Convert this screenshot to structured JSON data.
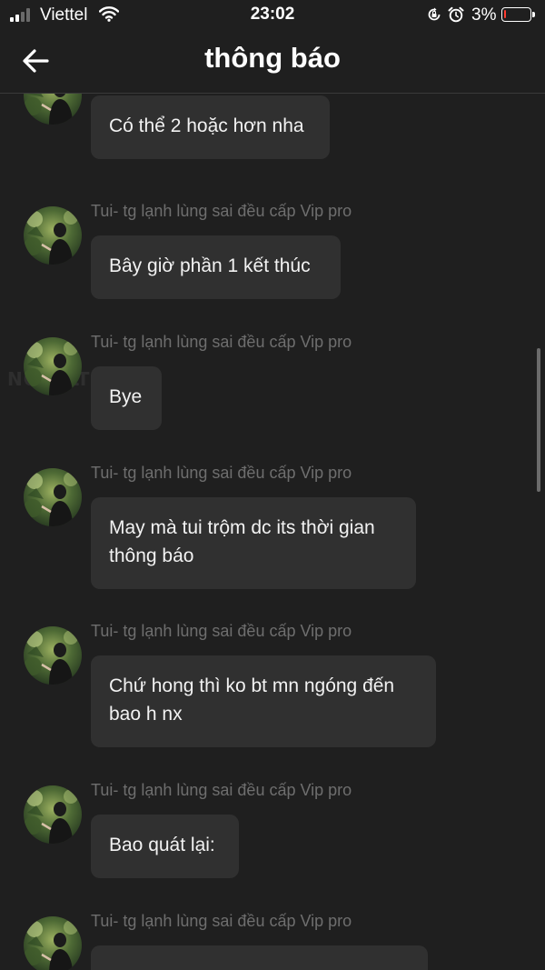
{
  "status_bar": {
    "carrier": "Viettel",
    "time": "23:02",
    "battery_percent": "3%",
    "battery_level": 0.03
  },
  "header": {
    "title": "thông báo",
    "back_icon": "arrow-left-icon"
  },
  "watermark": "NOVELTOON",
  "messages": [
    {
      "author": "",
      "text_lines": [
        "Có thể 2 hoặc hơn nha"
      ]
    },
    {
      "author": "Tui- tg lạnh lùng sai đều cấp Vip pro",
      "text_lines": [
        "Bây giờ phần 1 kết thúc"
      ]
    },
    {
      "author": "Tui- tg lạnh lùng sai đều cấp Vip pro",
      "text_lines": [
        "Bye"
      ]
    },
    {
      "author": "Tui- tg lạnh lùng sai đều cấp Vip pro",
      "text_lines": [
        "May mà tui trộm dc its thời gian",
        "thông báo"
      ]
    },
    {
      "author": "Tui- tg lạnh lùng sai đều cấp Vip pro",
      "text_lines": [
        "Chứ hong thì ko bt mn ngóng đến",
        "bao h nx"
      ]
    },
    {
      "author": "Tui- tg lạnh lùng sai đều cấp Vip pro",
      "text_lines": [
        "Bao quát lại:"
      ]
    },
    {
      "author": "Tui- tg lạnh lùng sai đều cấp Vip pro",
      "text_lines": [
        ""
      ]
    }
  ],
  "colors": {
    "background": "#1f1f1f",
    "bubble": "#303030",
    "author_text": "#6e6e6e",
    "battery_low": "#ff3b30"
  }
}
